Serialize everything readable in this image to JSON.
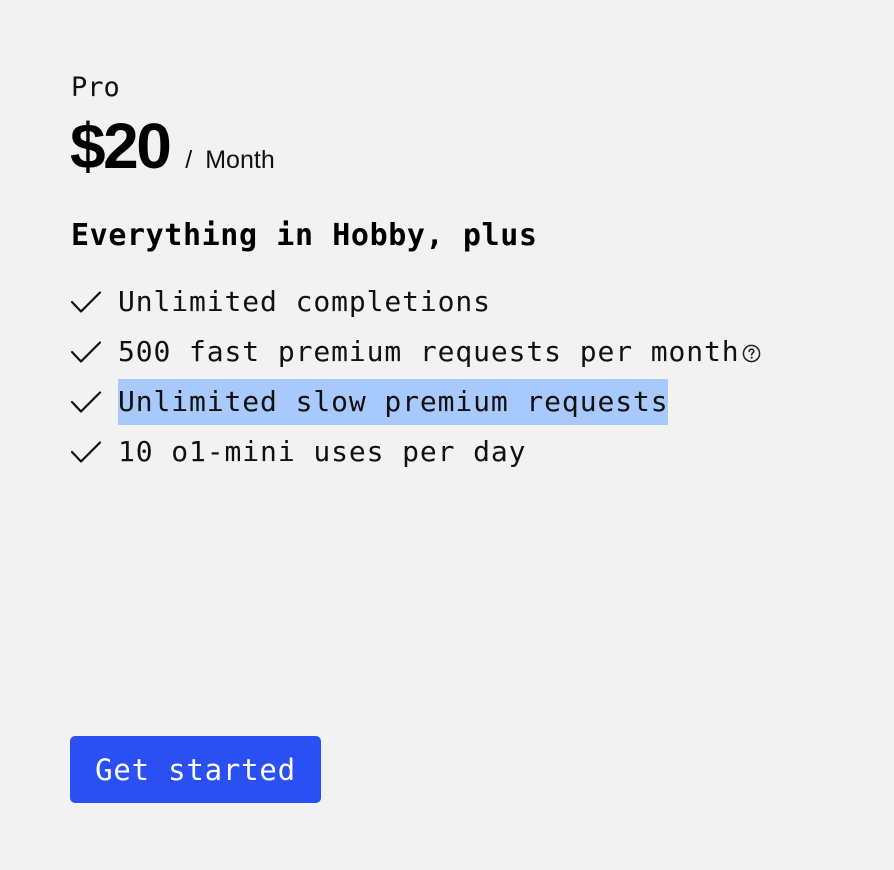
{
  "plan": {
    "name": "Pro",
    "price": "$20",
    "period_separator": "/",
    "period": "Month"
  },
  "features": {
    "heading": "Everything in Hobby, plus",
    "items": [
      {
        "label": "Unlimited completions",
        "icon": "check-icon"
      },
      {
        "label": "500 fast premium requests per month",
        "icon": "check-icon",
        "info_icon": "help-circle-icon"
      },
      {
        "label": "Unlimited slow premium requests",
        "icon": "check-icon",
        "selected": true
      },
      {
        "label": "10 o1-mini uses per day",
        "icon": "check-icon"
      }
    ]
  },
  "cta": {
    "label": "Get started"
  },
  "colors": {
    "background": "#f2f2f2",
    "accent": "#2a4ff2",
    "text_selection": "#a8c9fb"
  }
}
